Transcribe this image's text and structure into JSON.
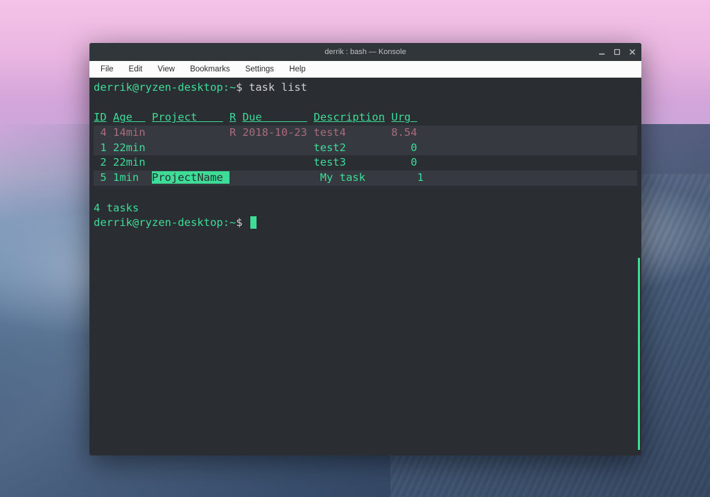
{
  "window": {
    "title": "derrik : bash — Konsole"
  },
  "menu": {
    "file": "File",
    "edit": "Edit",
    "view": "View",
    "bookmarks": "Bookmarks",
    "settings": "Settings",
    "help": "Help"
  },
  "prompt": {
    "user_host": "derrik@ryzen-desktop",
    "path": ":~",
    "dollar": "$"
  },
  "command": "task list",
  "headers": {
    "id": "ID",
    "age": "Age  ",
    "project": "Project    ",
    "r": "R",
    "due": "Due       ",
    "description": "Description",
    "urg": "Urg "
  },
  "rows": [
    {
      "id": " 4",
      "age": "14min",
      "project": "           ",
      "r": "R",
      "due": "2018-10-23",
      "description": "test4      ",
      "urg": "8.54",
      "style": "dimmed"
    },
    {
      "id": " 1",
      "age": "22min",
      "project": "           ",
      "r": " ",
      "due": "          ",
      "description": "test2      ",
      "urg": "   0",
      "style": "alt"
    },
    {
      "id": " 2",
      "age": "22min",
      "project": "           ",
      "r": " ",
      "due": "          ",
      "description": "test3      ",
      "urg": "   0",
      "style": "normal"
    },
    {
      "id": " 5",
      "age": "1min ",
      "project": "ProjectName ",
      "r": " ",
      "due": "          ",
      "description": "My task    ",
      "urg": "   1",
      "style": "highlight",
      "project_highlight": true
    }
  ],
  "summary": "4 tasks"
}
